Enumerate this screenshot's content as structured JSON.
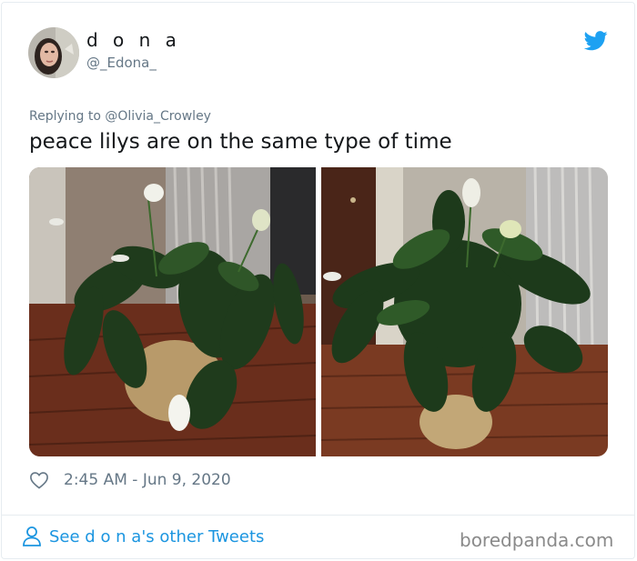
{
  "author": {
    "display_name": "d o n a",
    "handle": "@_Edona_"
  },
  "tweet": {
    "reply_prefix": "Replying to",
    "reply_to": "@Olivia_Crowley",
    "text": "peace lilys are on the same type of time",
    "timestamp": "2:45 AM - Jun 9, 2020"
  },
  "footer": {
    "see_tweets_label": "See d o n a's other Tweets",
    "watermark": "boredpanda.com"
  },
  "icons": {
    "brand": "twitter-bird-icon",
    "like": "heart-icon",
    "profile": "person-icon"
  },
  "colors": {
    "twitter_blue": "#1da1f2",
    "link_blue": "#1b95e0",
    "secondary_text": "#657786"
  }
}
